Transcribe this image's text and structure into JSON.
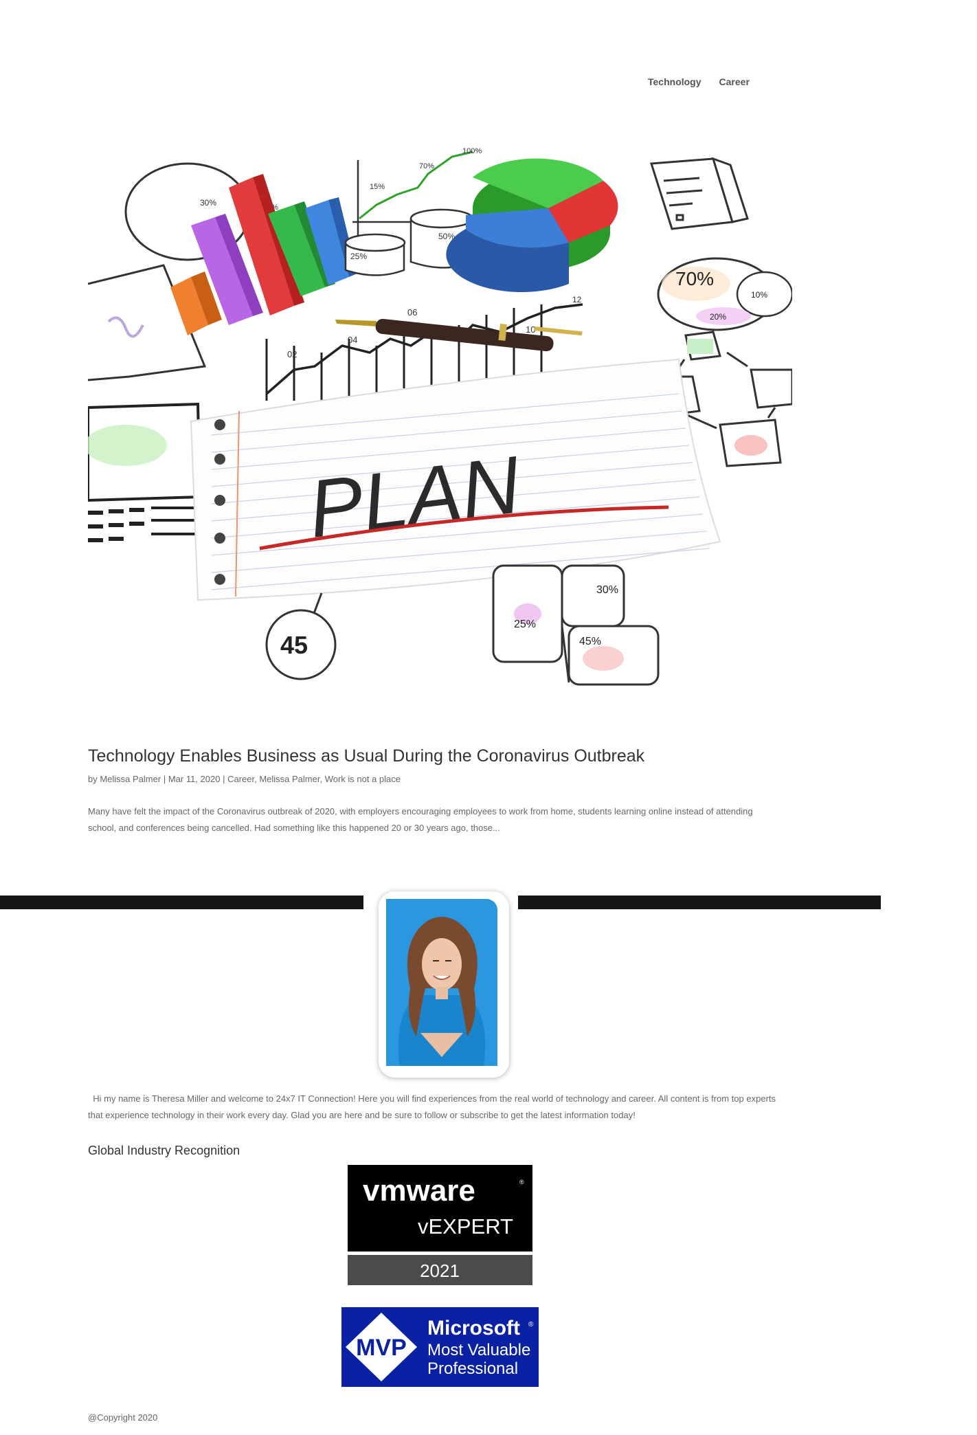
{
  "nav": {
    "items": [
      "Technology",
      "Career"
    ]
  },
  "hero": {
    "plan_text": "PLAN",
    "labels": {
      "p100": "100%",
      "p70": "70%",
      "p15": "15%",
      "p30": "30%",
      "p70b": "70%",
      "p25": "25%",
      "p50": "50%",
      "p70c": "70%",
      "p10": "10%",
      "p20": "20%",
      "n06": "06",
      "n12": "12",
      "n02": "02",
      "n04": "04",
      "n10": "10",
      "n45": "45",
      "p25b": "25%",
      "p30b": "30%",
      "p45": "45%"
    }
  },
  "post": {
    "title": "Technology Enables Business as Usual During the Coronavirus Outbreak",
    "meta_prefix": "by ",
    "author": "Melissa Palmer",
    "sep1": " | ",
    "date": "Mar 11, 2020",
    "sep2": " | ",
    "categories": [
      "Career",
      "Melissa Palmer",
      "Work is not a place"
    ],
    "cat_sep": ", ",
    "excerpt": "Many have felt the impact of the Coronavirus outbreak of 2020, with employers encouraging employees to work from home, students learning online instead of attending school, and conferences being cancelled.  Had something like this happened 20 or 30 years ago, those..."
  },
  "bio": {
    "text": "Hi my name is Theresa Miller and welcome to 24x7 IT Connection! Here you will find experiences from the real world of technology and career. All content is from top experts that experience technology in their work every day. Glad you are here and be sure to follow or subscribe to get the latest information today!"
  },
  "recognition": {
    "heading": "Global Industry Recognition",
    "vmware": {
      "brand": "vmware",
      "title": "vEXPERT",
      "year": "2021"
    },
    "mvp": {
      "badge": "MVP",
      "line1": "Microsoft",
      "line2": "Most Valuable",
      "line3": "Professional"
    }
  },
  "footer": {
    "copyright": "@Copyright 2020"
  },
  "colors": {
    "nav_text": "#555555",
    "title_text": "#333333",
    "body_text": "#666666",
    "divider_bar": "#161616",
    "photo_bg": "#1e8fd6",
    "vmware_black": "#000000",
    "vmware_gray": "#4b4b4e",
    "mvp_blue": "#0b21a3"
  }
}
